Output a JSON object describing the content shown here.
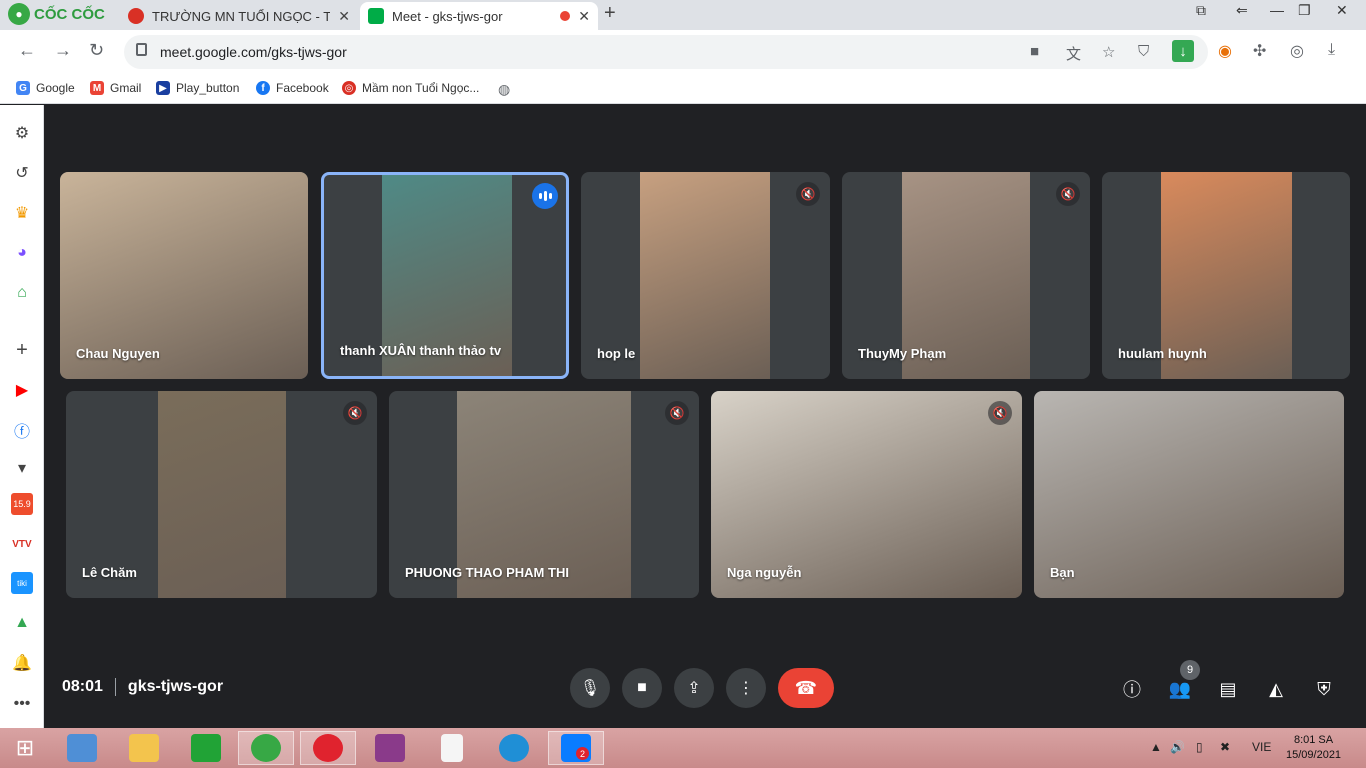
{
  "browser": {
    "logo": "CỐC CỐC",
    "tabs": [
      {
        "title": "TRƯỜNG MN TUỔI NGỌC - T",
        "active": false
      },
      {
        "title": "Meet - gks-tjws-gor",
        "active": true
      }
    ],
    "url": "meet.google.com/gks-tjws-gor",
    "bookmarks": [
      {
        "label": "Google",
        "icon": "google-icon",
        "color": "#4285f4"
      },
      {
        "label": "Gmail",
        "icon": "gmail-icon",
        "color": "#ea4335"
      },
      {
        "label": "Play_button",
        "icon": "play-icon",
        "color": "#1a3fa0"
      },
      {
        "label": "Facebook",
        "icon": "facebook-icon",
        "color": "#1877f2"
      },
      {
        "label": "Mầm non Tuổi Ngọc...",
        "icon": "site-icon",
        "color": "#d93025"
      }
    ]
  },
  "meeting": {
    "time": "08:01",
    "code": "gks-tjws-gor",
    "participant_count": "9",
    "tiles_row1": [
      {
        "name": "Chau Nguyen",
        "muted": false,
        "speaking": false,
        "color": "#c9b49a"
      },
      {
        "name": "thanh XUÂN thanh thảo tv",
        "muted": false,
        "speaking": true,
        "color": "#4f8a86"
      },
      {
        "name": "hop le",
        "muted": true,
        "speaking": false,
        "color": "#c7a080"
      },
      {
        "name": "ThuyMy Phạm",
        "muted": true,
        "speaking": false,
        "color": "#a79384"
      },
      {
        "name": "huulam huynh",
        "muted": false,
        "speaking": false,
        "color": "#d98a5c"
      }
    ],
    "tiles_row2": [
      {
        "name": "Lê Chăm",
        "muted": true,
        "speaking": false,
        "color": "#7a6d5a"
      },
      {
        "name": "PHUONG THAO PHAM THI",
        "muted": true,
        "speaking": false,
        "color": "#8c8478"
      },
      {
        "name": "Nga nguyễn",
        "muted": true,
        "speaking": false,
        "color": "#d8d2c8"
      },
      {
        "name": "Bạn",
        "muted": false,
        "speaking": false,
        "color": "#b9b6b2"
      }
    ],
    "controls": [
      "mic-icon",
      "camera-icon",
      "present-icon",
      "more-icon",
      "end-call-icon"
    ],
    "right_controls": [
      "info-icon",
      "people-icon",
      "chat-icon",
      "activities-icon",
      "host-controls-icon"
    ]
  },
  "taskbar": {
    "language": "VIE",
    "time": "8:01 SA",
    "date": "15/09/2021",
    "zalo_badge": "2"
  }
}
